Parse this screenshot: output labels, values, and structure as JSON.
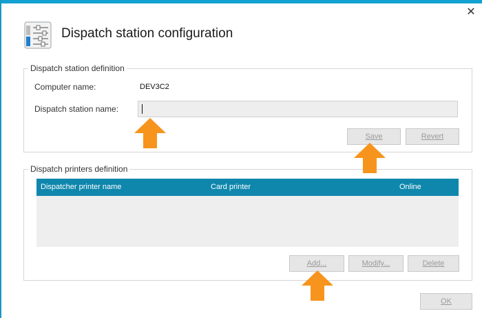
{
  "window": {
    "title": "Dispatch station configuration",
    "close_glyph": "✕",
    "app_icon": "settings-sliders-icon"
  },
  "station_definition": {
    "legend": "Dispatch station definition",
    "computer_name_label": "Computer name:",
    "computer_name_value": "DEV3C2",
    "station_name_label": "Dispatch station name:",
    "station_name_value": "",
    "save_label": "Save",
    "revert_label": "Revert"
  },
  "printers_definition": {
    "legend": "Dispatch printers definition",
    "columns": [
      "Dispatcher printer name",
      "Card printer",
      "Online"
    ],
    "rows": [],
    "add_label": "Add...",
    "modify_label": "Modify...",
    "delete_label": "Delete"
  },
  "footer": {
    "ok_label": "OK"
  },
  "colors": {
    "accent": "#12a1d1",
    "grid_header": "#0f87ad",
    "arrow": "#f7941d"
  }
}
